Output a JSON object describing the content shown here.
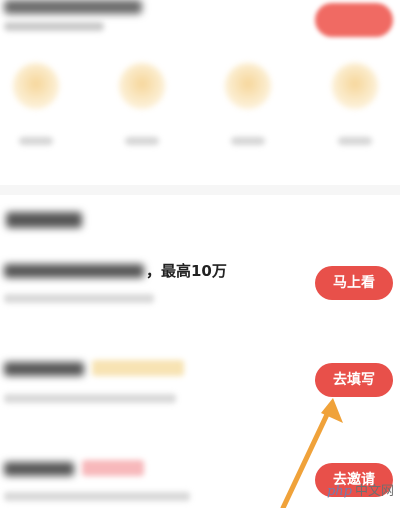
{
  "tasks": [
    {
      "title_suffix": "，最高10万",
      "button": "马上看"
    },
    {
      "button": "去填写"
    },
    {
      "button": "去邀请"
    }
  ],
  "watermark": {
    "brand": "php",
    "text": "中文网"
  },
  "colors": {
    "accent": "#e8504a",
    "arrow": "#f0a23a",
    "coin": "#f6d69a"
  }
}
